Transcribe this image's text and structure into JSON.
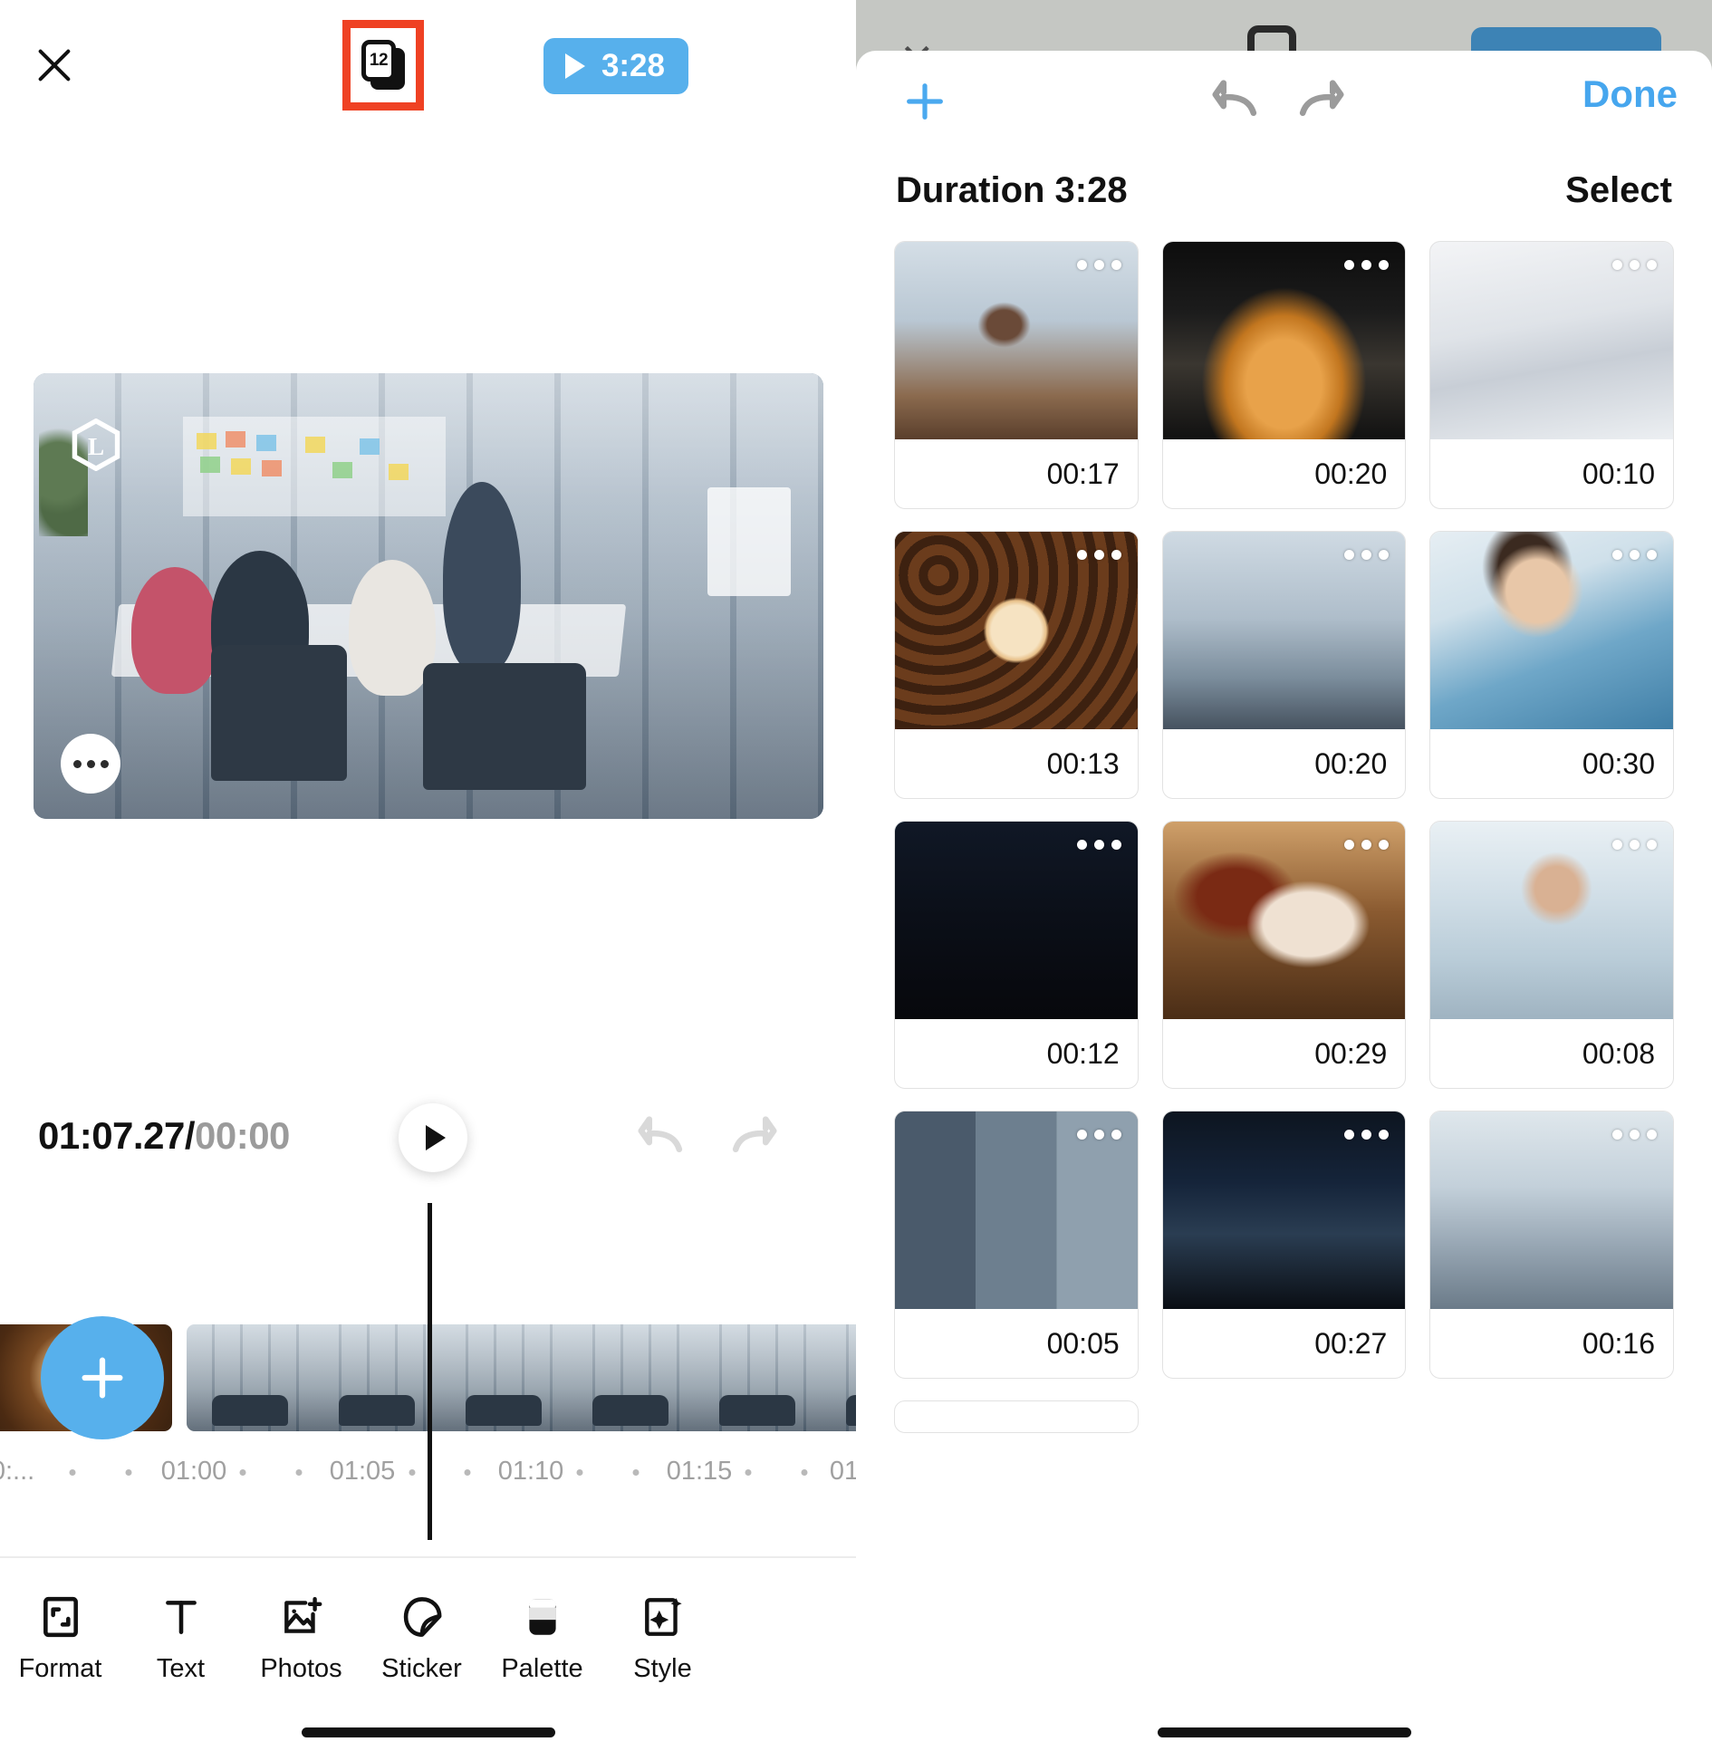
{
  "left": {
    "close_icon": "close-icon",
    "cards_badge_count": "12",
    "cards_icon": "layers-stack-icon",
    "play_icon": "play-icon",
    "total_duration": "3:28",
    "preview": {
      "logo_letter": "L",
      "more_icon": "more-horizontal-icon"
    },
    "transport": {
      "current_time": "01:07.27",
      "separator": "/",
      "total_time": "00:00",
      "play_icon": "play-icon",
      "undo_icon": "undo-icon",
      "redo_icon": "redo-icon"
    },
    "timeline": {
      "add_icon": "plus-icon",
      "ruler_labels": [
        "0:...",
        "01:00",
        "01:05",
        "01:10",
        "01:15",
        "01:"
      ]
    },
    "toolbar": [
      {
        "label": "Format",
        "icon": "format-frame-icon"
      },
      {
        "label": "Text",
        "icon": "text-t-icon"
      },
      {
        "label": "Photos",
        "icon": "photo-add-icon"
      },
      {
        "label": "Sticker",
        "icon": "sticker-icon"
      },
      {
        "label": "Palette",
        "icon": "palette-icon"
      },
      {
        "label": "Style",
        "icon": "style-sparkle-icon"
      }
    ]
  },
  "right": {
    "header": {
      "add_icon": "plus-icon",
      "undo_icon": "undo-icon",
      "redo_icon": "redo-icon",
      "done_label": "Done"
    },
    "meta": {
      "duration_label": "Duration 3:28",
      "select_label": "Select"
    },
    "clips": [
      {
        "duration": "00:17",
        "art": "t-meeting1",
        "menu_icon": "more-horizontal-icon"
      },
      {
        "duration": "00:20",
        "art": "t-coffeepot",
        "menu_icon": "more-horizontal-icon"
      },
      {
        "duration": "00:10",
        "art": "t-keyboard",
        "menu_icon": "more-horizontal-icon"
      },
      {
        "duration": "00:13",
        "art": "t-beans",
        "menu_icon": "more-horizontal-icon"
      },
      {
        "duration": "00:20",
        "art": "t-meeting2",
        "menu_icon": "more-horizontal-icon"
      },
      {
        "duration": "00:30",
        "art": "t-woman",
        "menu_icon": "more-horizontal-icon"
      },
      {
        "duration": "00:12",
        "art": "t-dark",
        "menu_icon": "more-horizontal-icon"
      },
      {
        "duration": "00:29",
        "art": "t-mug",
        "menu_icon": "more-horizontal-icon"
      },
      {
        "duration": "00:08",
        "art": "t-manlaptop",
        "menu_icon": "more-horizontal-icon"
      },
      {
        "duration": "00:05",
        "art": "t-grid",
        "menu_icon": "more-horizontal-icon"
      },
      {
        "duration": "00:27",
        "art": "t-desk",
        "menu_icon": "more-horizontal-icon"
      },
      {
        "duration": "00:16",
        "art": "t-office",
        "menu_icon": "more-horizontal-icon"
      }
    ]
  },
  "colors": {
    "accent_blue": "#57b0ec",
    "link_blue": "#46a6ee",
    "highlight_red": "#ef4123",
    "backdrop_gray": "#c5c7c3"
  }
}
